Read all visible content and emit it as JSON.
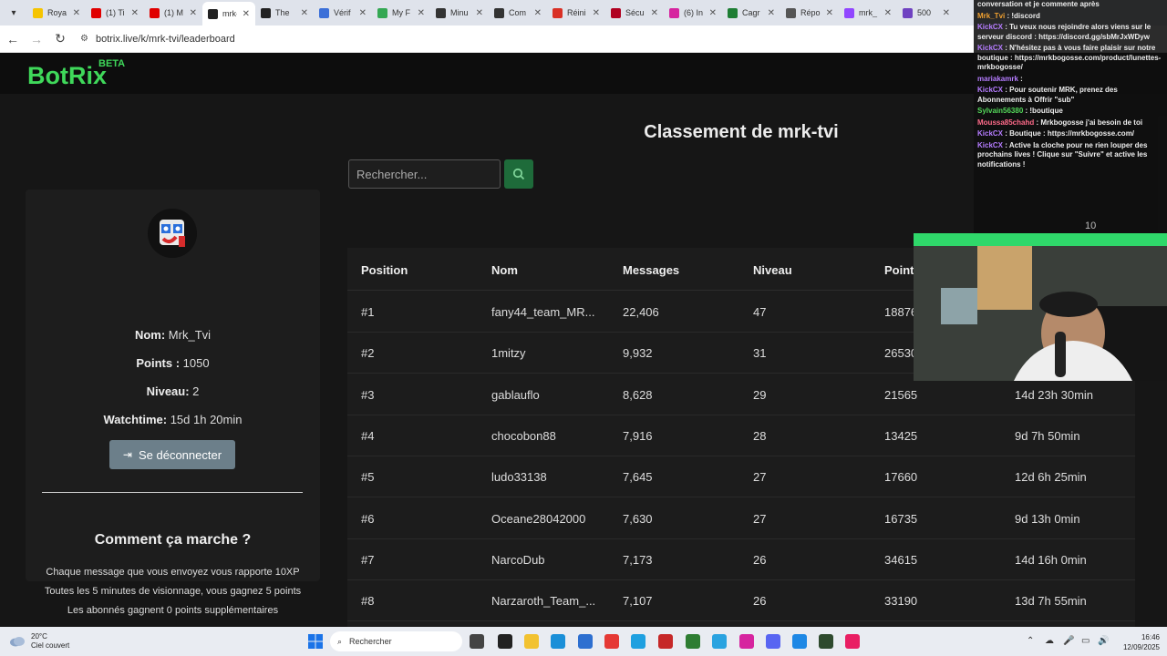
{
  "browser": {
    "tabs": [
      {
        "label": "Roya",
        "color": "#f5c400"
      },
      {
        "label": "(1) Ti",
        "color": "#e00000"
      },
      {
        "label": "(1) M",
        "color": "#e00000"
      },
      {
        "label": "mrk-",
        "color": "#222222",
        "active": true
      },
      {
        "label": "The",
        "color": "#222222"
      },
      {
        "label": "Vérif",
        "color": "#3b6fd8"
      },
      {
        "label": "My F",
        "color": "#34a853"
      },
      {
        "label": "Minu",
        "color": "#333333"
      },
      {
        "label": "Com",
        "color": "#333333"
      },
      {
        "label": "Réini",
        "color": "#d93025"
      },
      {
        "label": "Sécu",
        "color": "#b00020"
      },
      {
        "label": "(6) In",
        "color": "#d6249f"
      },
      {
        "label": "Cagr",
        "color": "#1e7e34"
      },
      {
        "label": "Répo",
        "color": "#555555"
      },
      {
        "label": "mrk_",
        "color": "#9146ff"
      },
      {
        "label": "500",
        "color": "#6f42c1"
      }
    ],
    "url": "botrix.live/k/mrk-tvi/leaderboard"
  },
  "site": {
    "logo": "BotRix",
    "beta": "BETA"
  },
  "leaderboard": {
    "title": "Classement de mrk-tvi",
    "search_placeholder": "Rechercher...",
    "columns": [
      "Position",
      "Nom",
      "Messages",
      "Niveau",
      "Point"
    ],
    "rows": [
      {
        "pos": "#1",
        "name": "fany44_team_MR...",
        "messages": "22,406",
        "level": "47",
        "points": "18876",
        "watchtime": ""
      },
      {
        "pos": "#2",
        "name": "1mitzy",
        "messages": "9,932",
        "level": "31",
        "points": "26530",
        "watchtime": ""
      },
      {
        "pos": "#3",
        "name": "gablauflo",
        "messages": "8,628",
        "level": "29",
        "points": "21565",
        "watchtime": "14d 23h 30min"
      },
      {
        "pos": "#4",
        "name": "chocobon88",
        "messages": "7,916",
        "level": "28",
        "points": "13425",
        "watchtime": "9d 7h 50min"
      },
      {
        "pos": "#5",
        "name": "ludo33138",
        "messages": "7,645",
        "level": "27",
        "points": "17660",
        "watchtime": "12d 6h 25min"
      },
      {
        "pos": "#6",
        "name": "Oceane28042000",
        "messages": "7,630",
        "level": "27",
        "points": "16735",
        "watchtime": "9d 13h 0min"
      },
      {
        "pos": "#7",
        "name": "NarcoDub",
        "messages": "7,173",
        "level": "26",
        "points": "34615",
        "watchtime": "14d 16h 0min"
      },
      {
        "pos": "#8",
        "name": "Narzaroth_Team_...",
        "messages": "7,107",
        "level": "26",
        "points": "33190",
        "watchtime": "13d 7h 55min"
      }
    ]
  },
  "profile": {
    "name_label": "Nom:",
    "name_value": " Mrk_Tvi",
    "points_label": "Points :",
    "points_value": " 1050",
    "level_label": "Niveau:",
    "level_value": " 2",
    "watchtime_label": "Watchtime:",
    "watchtime_value": " 15d 1h 20min",
    "logout_label": "Se déconnecter"
  },
  "how": {
    "title": "Comment ça marche ?",
    "lines": [
      "Chaque message que vous envoyez vous rapporte 10XP",
      "Toutes les 5 minutes de visionnage, vous gagnez 5 points",
      "Les abonnés gagnent 0 points supplémentaires"
    ]
  },
  "chat": {
    "messages": [
      {
        "user": "",
        "text": "conversation et je commente après"
      },
      {
        "user": "Mrk_Tvi",
        "text": ": !discord",
        "color": "#f0a030"
      },
      {
        "user": "KickCX",
        "text": ": Tu veux nous rejoindre alors viens sur le serveur discord : https://discord.gg/sbMrJxWDyw",
        "color": "#b57cff"
      },
      {
        "user": "KickCX",
        "text": ": N'hésitez pas à vous faire plaisir sur notre boutique : https://mrkbogosse.com/product/lunettes-mrkbogosse/",
        "color": "#b57cff"
      },
      {
        "user": "mariakamrk",
        "text": ":",
        "color": "#b57cff"
      },
      {
        "user": "KickCX",
        "text": ": Pour soutenir MRK, prenez des Abonnements à Offrir \"sub\"",
        "color": "#b57cff"
      },
      {
        "user": "Sylvain56380",
        "text": ": !boutique",
        "color": "#54d85a"
      },
      {
        "user": "Moussa85chahd",
        "text": ": Mrkbogosse j'ai besoin de toi",
        "color": "#ff6b8a"
      },
      {
        "user": "KickCX",
        "text": ": Boutique : https://mrkbogosse.com/",
        "color": "#b57cff"
      },
      {
        "user": "KickCX",
        "text": ": Active la cloche pour ne rien louper des prochains lives ! Clique sur \"Suivre\" et active les notifications !",
        "color": "#b57cff"
      }
    ],
    "count": "10"
  },
  "taskbar": {
    "temp": "20°C",
    "weather": "Ciel couvert",
    "search": "Rechercher",
    "time": "16:46",
    "date": "12/09/2025"
  }
}
